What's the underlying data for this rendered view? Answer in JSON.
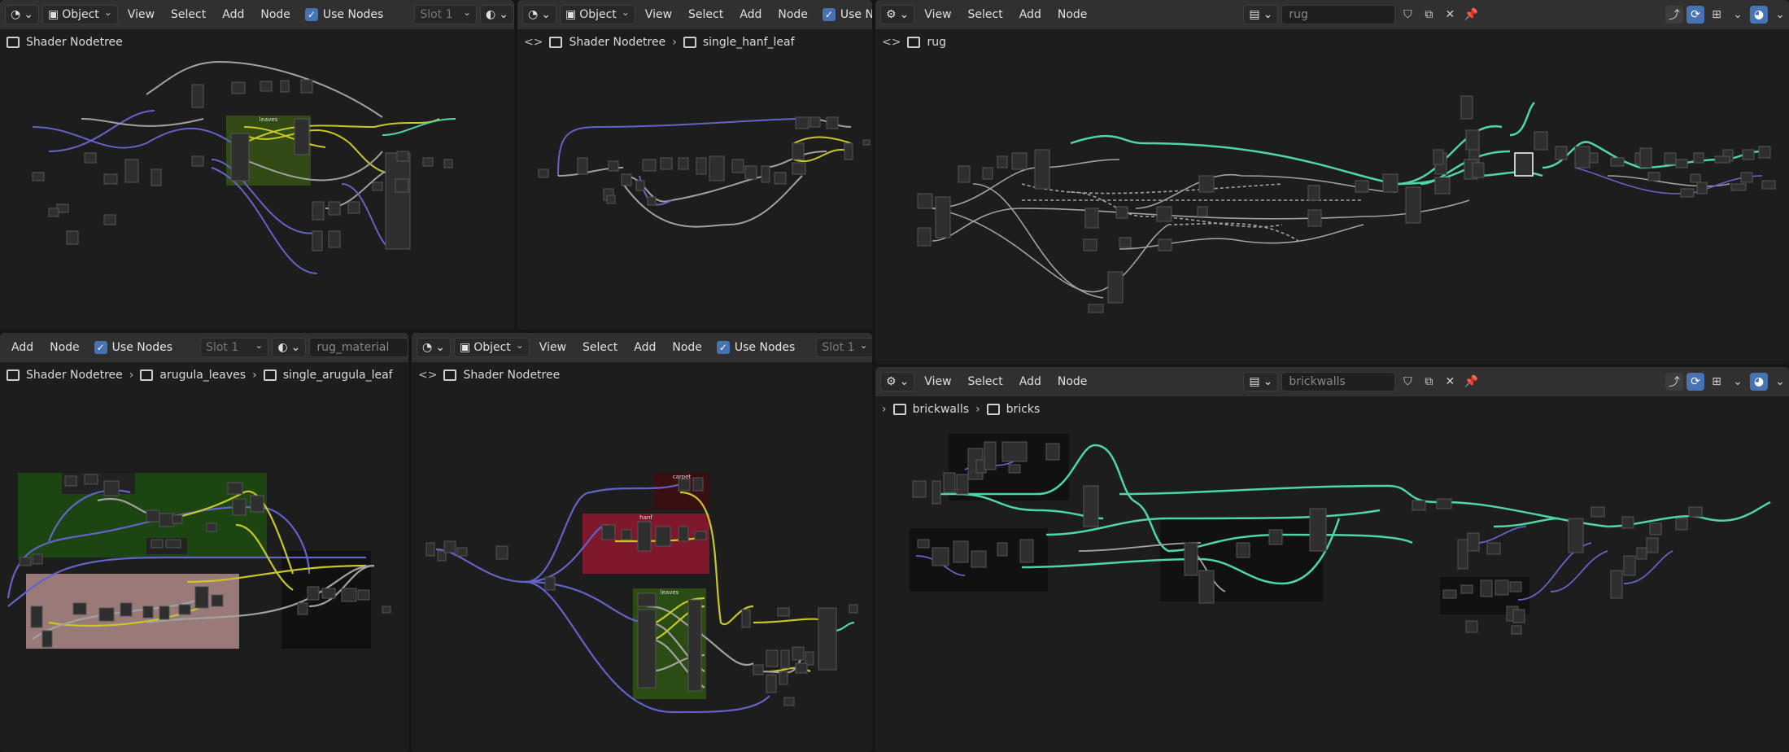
{
  "areas": {
    "tl": {
      "mode_label": "Object",
      "menus": [
        "View",
        "Select",
        "Add",
        "Node"
      ],
      "use_nodes_label": "Use Nodes",
      "slot_label": "Slot 1",
      "breadcrumb": [
        "Shader Nodetree"
      ],
      "frames": [
        "leaves"
      ]
    },
    "tm": {
      "mode_label": "Object",
      "menus": [
        "View",
        "Select",
        "Add",
        "Node"
      ],
      "use_nodes_label": "Use Noc",
      "breadcrumb": [
        "Shader Nodetree",
        "single_hanf_leaf"
      ]
    },
    "tr": {
      "menus": [
        "View",
        "Select",
        "Add",
        "Node"
      ],
      "datablock_value": "rug",
      "breadcrumb": [
        "rug"
      ]
    },
    "bl": {
      "menus": [
        "Add",
        "Node"
      ],
      "use_nodes_label": "Use Nodes",
      "slot_label": "Slot 1",
      "material_value": "rug_material",
      "breadcrumb": [
        "Shader Nodetree",
        "arugula_leaves",
        "single_arugula_leaf"
      ]
    },
    "bm": {
      "mode_label": "Object",
      "menus": [
        "View",
        "Select",
        "Add",
        "Node"
      ],
      "use_nodes_label": "Use Nodes",
      "slot_label": "Slot 1",
      "breadcrumb": [
        "Shader Nodetree"
      ],
      "frames": [
        "carpet",
        "hanf",
        "leaves"
      ]
    },
    "br": {
      "menus": [
        "View",
        "Select",
        "Add",
        "Node"
      ],
      "datablock_value": "brickwalls",
      "breadcrumb": [
        "brickwalls",
        "bricks"
      ]
    }
  },
  "colors": {
    "header": "#303030",
    "canvas": "#1d1d1d",
    "accent": "#4772b3",
    "wire_shader": "#4ed6a3",
    "wire_vector": "#6363c7",
    "wire_float": "#a1a1a1",
    "wire_color": "#c7c729"
  }
}
